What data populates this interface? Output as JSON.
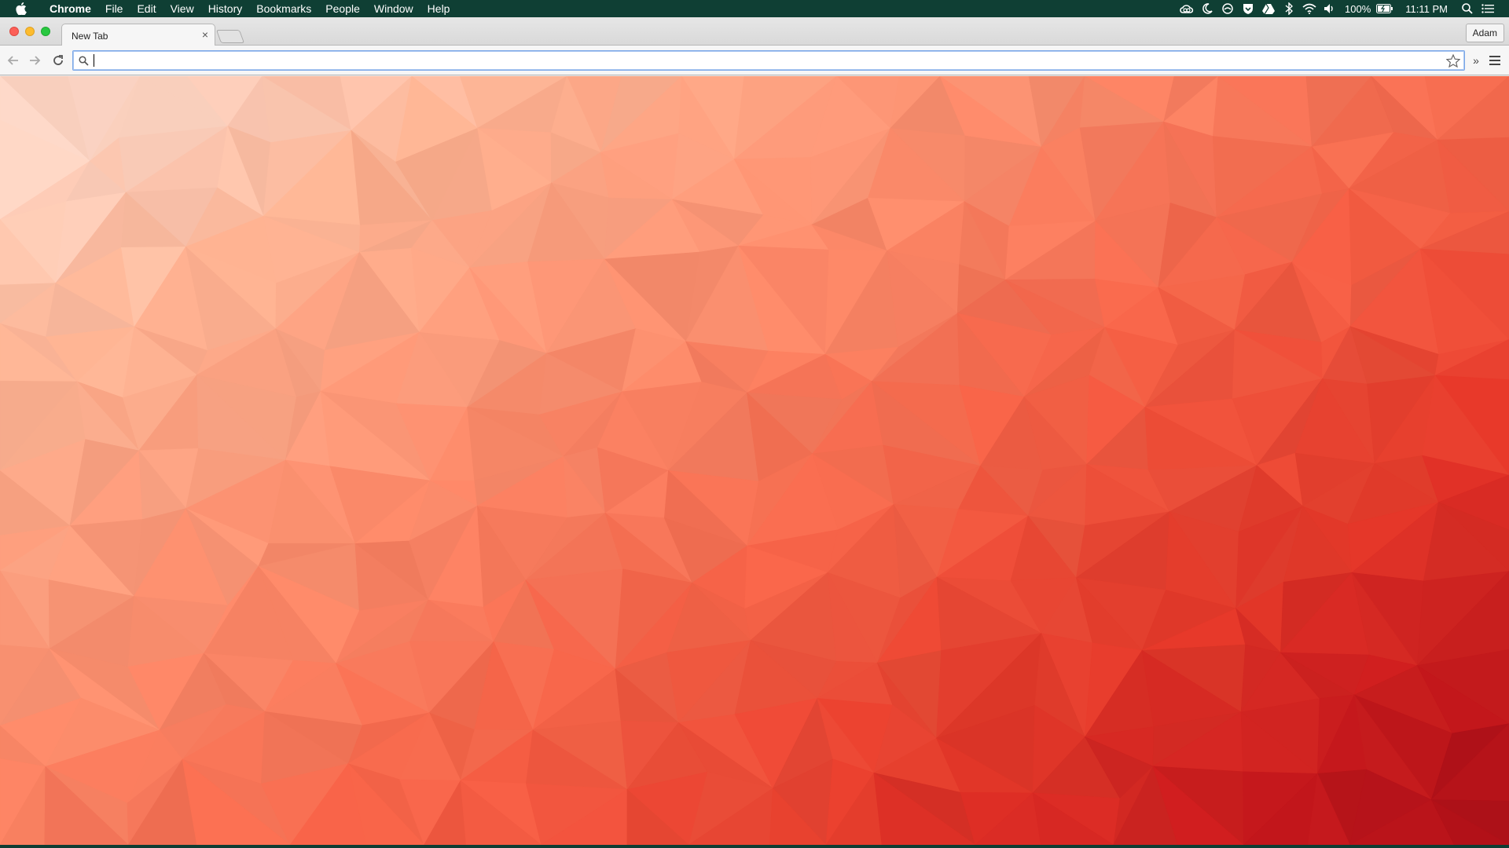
{
  "menubar": {
    "app_name": "Chrome",
    "menus": [
      "File",
      "Edit",
      "View",
      "History",
      "Bookmarks",
      "People",
      "Window",
      "Help"
    ],
    "battery": "100%",
    "time": "11:11 PM",
    "status_icons": [
      "creative-cloud-icon",
      "moon-icon",
      "sync-icon",
      "shield-icon",
      "google-drive-icon",
      "bluetooth-icon",
      "wifi-icon",
      "volume-icon"
    ]
  },
  "browser": {
    "tab_title": "New Tab",
    "tab_close": "×",
    "profile_name": "Adam",
    "omnibox_value": "",
    "overflow_label": "»"
  },
  "colors": {
    "menubar_bg": "#0f3f34",
    "gradient_light": "#ffe0d4",
    "gradient_mid": "#f46347",
    "gradient_dark": "#a50e18"
  }
}
